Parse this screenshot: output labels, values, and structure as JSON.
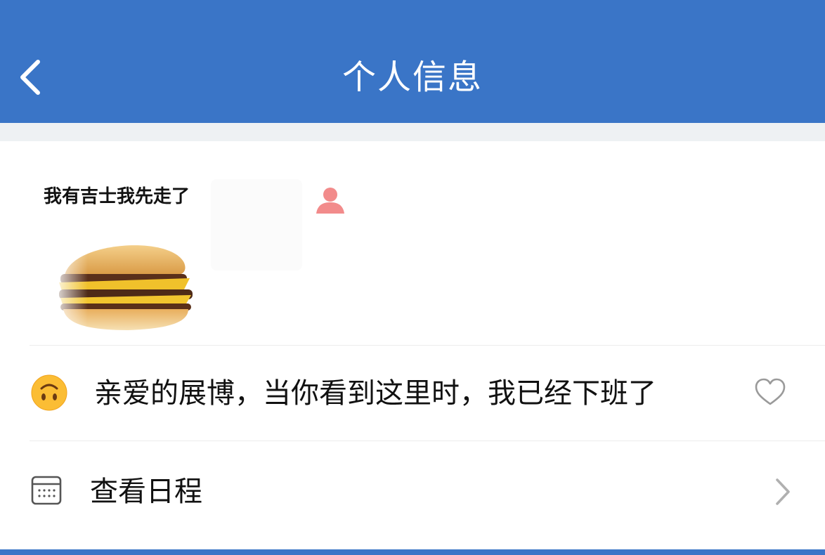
{
  "header": {
    "title": "个人信息",
    "back_icon": "chevron-left-icon",
    "background_color": "#3a75c7"
  },
  "profile": {
    "name": "我有吉士我先走了",
    "gender_icon": "user-icon",
    "avatar_image": "burger"
  },
  "status_row": {
    "emoji": "upside-down-face",
    "text": "亲爱的展博，当你看到这里时，我已经下班了",
    "like_icon": "heart-outline-icon"
  },
  "schedule_row": {
    "icon": "calendar-icon",
    "label": "查看日程",
    "chevron": "chevron-right-icon"
  }
}
